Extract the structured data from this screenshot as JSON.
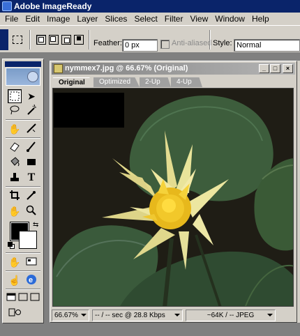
{
  "app": {
    "title": "Adobe ImageReady"
  },
  "menu": {
    "items": [
      "File",
      "Edit",
      "Image",
      "Layer",
      "Slices",
      "Select",
      "Filter",
      "View",
      "Window",
      "Help"
    ]
  },
  "options": {
    "feather_label": "Feather:",
    "feather_value": "0 px",
    "antialiased_label": "Anti-aliased",
    "style_label": "Style:",
    "style_value": "Normal"
  },
  "document": {
    "title": "nymmex7.jpg @ 66.67% (Original)",
    "tabs": [
      "Original",
      "Optimized",
      "2-Up",
      "4-Up"
    ],
    "active_tab": "Original",
    "status": {
      "zoom": "66.67%",
      "timing": "-- / -- sec @ 28.8 Kbps",
      "size": "~64K / -- JPEG"
    }
  },
  "icons": {
    "minimize": "minimize-icon",
    "maximize": "maximize-icon",
    "close": "close-icon"
  },
  "colors": {
    "title_active": "#0a246a",
    "chrome": "#d4d0c8",
    "foreground": "#000000",
    "background": "#ffffff"
  }
}
